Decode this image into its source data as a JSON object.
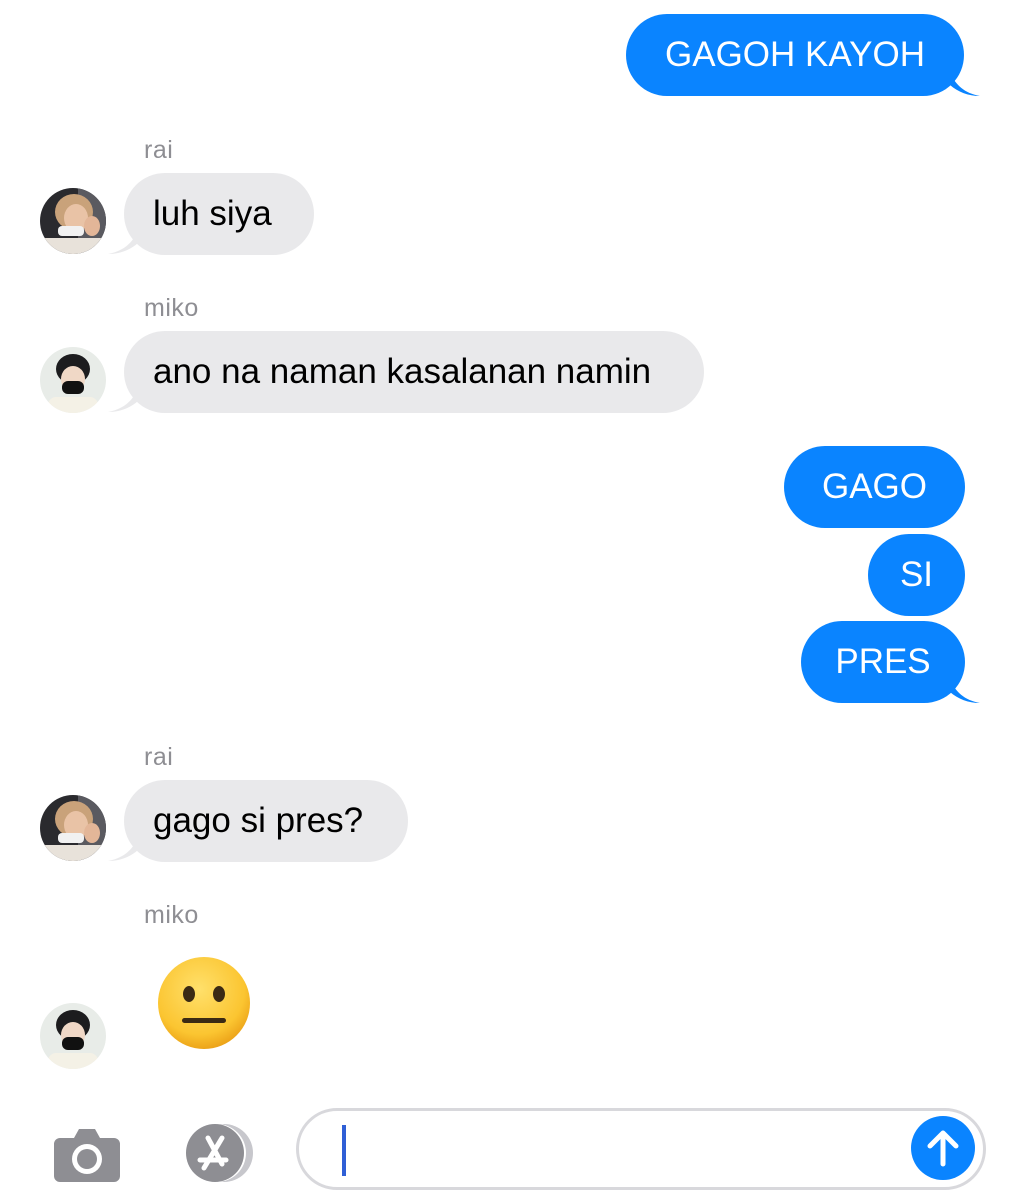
{
  "conversation": {
    "messages": [
      {
        "direction": "outgoing",
        "text": "GAGOH KAYOH"
      },
      {
        "direction": "incoming",
        "sender": "rai",
        "text": "luh siya"
      },
      {
        "direction": "incoming",
        "sender": "miko",
        "text": "ano na naman kasalanan namin"
      },
      {
        "direction": "outgoing",
        "text": "GAGO"
      },
      {
        "direction": "outgoing",
        "text": "SI"
      },
      {
        "direction": "outgoing",
        "text": "PRES"
      },
      {
        "direction": "incoming",
        "sender": "rai",
        "text": "gago si pres?"
      },
      {
        "direction": "incoming",
        "sender": "miko",
        "emoji": "neutral-face-emoji"
      }
    ]
  },
  "composer": {
    "value": "",
    "camera_icon": "camera-icon",
    "apps_icon": "app-store-icon",
    "send_icon": "arrow-up-icon"
  },
  "colors": {
    "outgoing_bubble": "#0a84ff",
    "incoming_bubble": "#e9e9eb",
    "sender_name": "#8e8e93",
    "caret": "#2f5fd6"
  }
}
